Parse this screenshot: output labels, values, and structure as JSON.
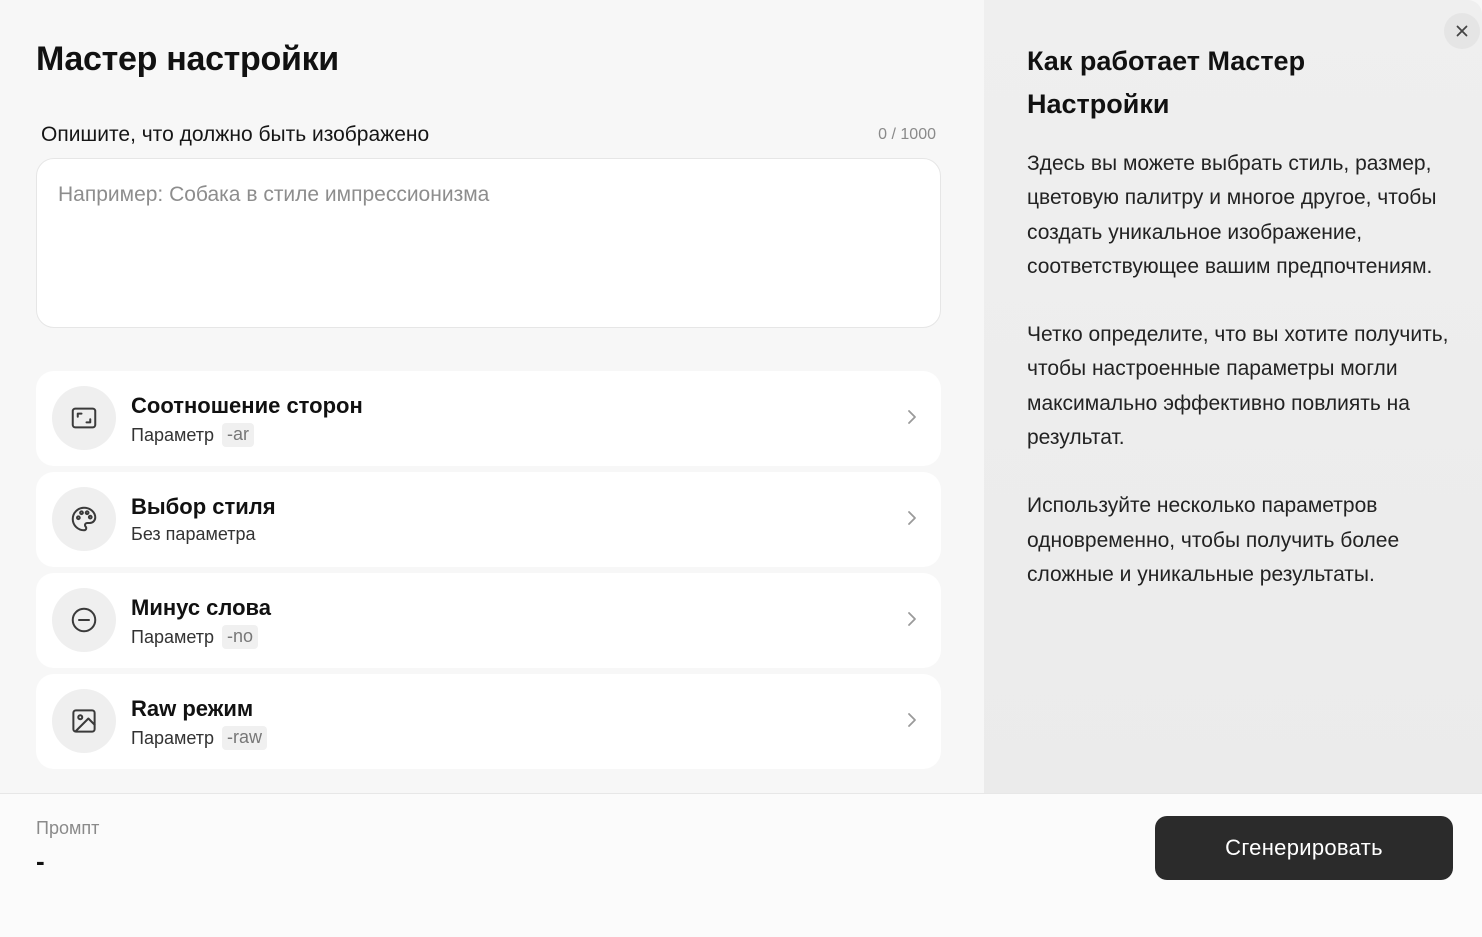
{
  "wizard": {
    "title": "Мастер настройки",
    "close_icon": "close-icon"
  },
  "description": {
    "label": "Опишите, что должно быть изображено",
    "counter": "0 / 1000",
    "value": "",
    "placeholder": "Например: Собака в стиле импрессионизма"
  },
  "params": [
    {
      "title": "Соотношение сторон",
      "sub": "Параметр",
      "code": "-ar",
      "icon": "aspect-ratio-icon"
    },
    {
      "title": "Выбор стиля",
      "sub": "Без параметра",
      "code": "",
      "icon": "palette-icon"
    },
    {
      "title": "Минус слова",
      "sub": "Параметр",
      "code": "-no",
      "icon": "minus-circle-icon"
    },
    {
      "title": "Raw режим",
      "sub": "Параметр",
      "code": "-raw",
      "icon": "image-icon"
    }
  ],
  "help": {
    "title": "Как работает Мастер Настройки",
    "paragraphs": [
      "Здесь вы можете выбрать стиль, размер, цветовую палитру и многое другое, чтобы создать уникальное изображение, соответствующее вашим предпочтениям.",
      "Четко определите, что вы хотите получить, чтобы настроенные параметры могли максимально эффективно повлиять на результат.",
      "Используйте несколько параметров одновременно, чтобы получить более сложные и уникальные результаты."
    ]
  },
  "footer": {
    "prompt_label": "Промпт",
    "prompt_value": "-",
    "generate_label": "Сгенерировать"
  },
  "colors": {
    "button_bg": "#2b2b2b",
    "panel_bg": "#ededed",
    "card_bg": "#ffffff"
  }
}
